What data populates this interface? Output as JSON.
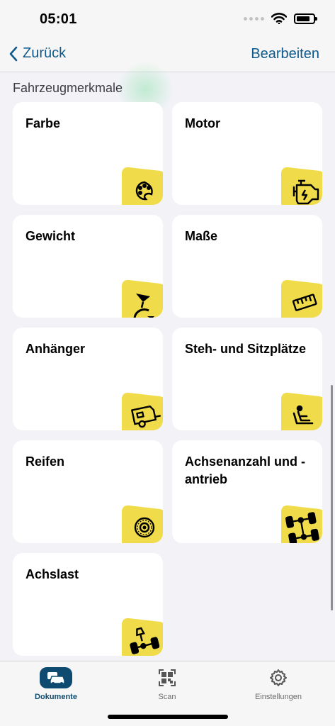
{
  "status_bar": {
    "time": "05:01"
  },
  "nav": {
    "back_label": "Zurück",
    "edit_label": "Bearbeiten"
  },
  "section": {
    "title": "Fahrzeugmerkmale"
  },
  "cards": [
    {
      "label": "Farbe",
      "icon": "palette-icon"
    },
    {
      "label": "Motor",
      "icon": "engine-icon"
    },
    {
      "label": "Gewicht",
      "icon": "weight-icon"
    },
    {
      "label": "Maße",
      "icon": "ruler-icon"
    },
    {
      "label": "Anhänger",
      "icon": "trailer-icon"
    },
    {
      "label": "Steh- und Sitzplätze",
      "icon": "seat-icon"
    },
    {
      "label": "Reifen",
      "icon": "tire-icon"
    },
    {
      "label": "Achsenanzahl und -antrieb",
      "icon": "axle-drive-icon"
    },
    {
      "label": "Achslast",
      "icon": "axle-load-icon"
    }
  ],
  "tabs": [
    {
      "label": "Dokumente",
      "icon": "car-documents-icon",
      "active": true
    },
    {
      "label": "Scan",
      "icon": "qr-scan-icon",
      "active": false
    },
    {
      "label": "Einstellungen",
      "icon": "gear-icon",
      "active": false
    }
  ],
  "colors": {
    "accent": "#0f5a8a",
    "tab_active": "#0f4a70",
    "badge_yellow": "#f0dc4a",
    "background": "#f2f2f7"
  }
}
